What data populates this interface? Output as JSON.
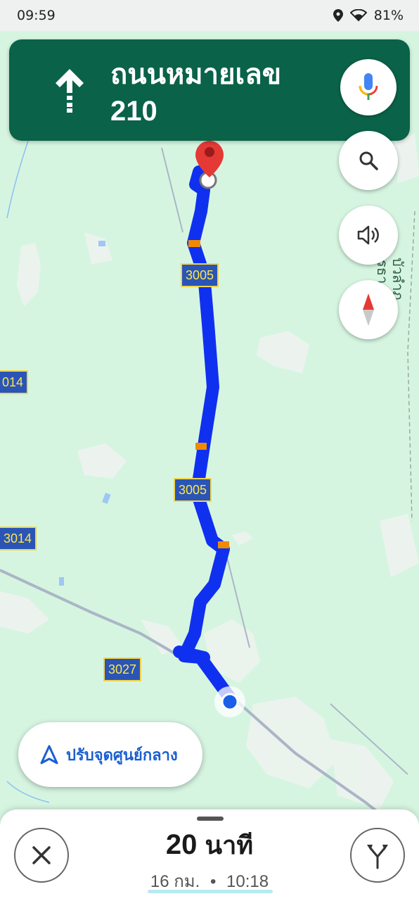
{
  "status_bar": {
    "time": "09:59",
    "battery": "81%",
    "icons": [
      "location-icon",
      "wifi-icon"
    ]
  },
  "nav_banner": {
    "direction_icon": "straight-arrow-icon",
    "road_line1": "ถนนหมายเลข",
    "road_line2": "210",
    "mic_icon": "google-mic-icon",
    "color": "#0a6248"
  },
  "map_controls": {
    "search_icon": "search-icon",
    "sound_icon": "volume-icon",
    "compass_icon": "compass-icon"
  },
  "road_labels": {
    "r3005_top": "3005",
    "r3005_bottom": "3005",
    "r3014_top": "014",
    "r3014_bottom": "3014",
    "r3027": "3027"
  },
  "map_text": {
    "edge_text_1": "อุดรธา",
    "edge_text_2": "บัวลำภู"
  },
  "recenter": {
    "icon": "navigation-arrow-icon",
    "label": "ปรับจุดศูนย์กลาง"
  },
  "bottom_sheet": {
    "eta_value": "20",
    "eta_unit": "นาที",
    "arrival_distance": "16 กม.",
    "separator": "•",
    "arrival_time": "10:18",
    "close_icon": "close-icon",
    "alternate_routes_icon": "fork-routes-icon"
  },
  "colors": {
    "route": "#1030f0",
    "traffic": "#f08a00",
    "map_bg": "#d6f5e1",
    "accent": "#1a5fd0"
  }
}
